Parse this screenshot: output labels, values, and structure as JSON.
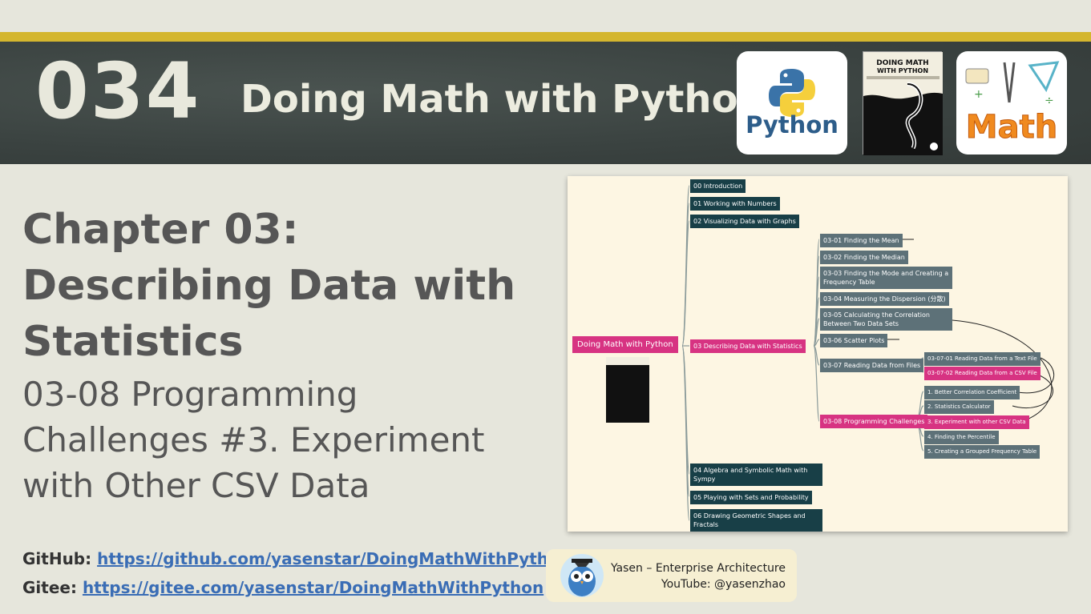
{
  "header": {
    "episode_number": "034",
    "title": "Doing Math with Python",
    "logos": {
      "python": {
        "label": "Python",
        "icon": "python-logo-icon"
      },
      "book": {
        "title": "DOING MATH WITH PYTHON",
        "icon": "book-cover-icon"
      },
      "math": {
        "label": "Math",
        "icon": "math-tools-icon"
      }
    }
  },
  "main": {
    "chapter_title": "Chapter 03: Describing Data with Statistics",
    "section_title": "03-08 Programming Challenges #3. Experiment with Other CSV Data"
  },
  "links": {
    "github_label": "GitHub:",
    "github_url": "https://github.com/yasenstar/DoingMathWithPython",
    "gitee_label": "Gitee:",
    "gitee_url": "https://gitee.com/yasenstar/DoingMathWithPython"
  },
  "mindmap": {
    "root": "Doing Math with Python",
    "chapters": [
      "00 Introduction",
      "01 Working with Numbers",
      "02 Visualizing Data with Graphs",
      "03 Describing Data with Statistics",
      "04 Algebra and Symbolic Math with Sympy",
      "05 Playing with Sets and Probability",
      "06 Drawing Geometric Shapes and Fractals"
    ],
    "ch03_sections": [
      "03-01 Finding the Mean",
      "03-02 Finding the Median",
      "03-03 Finding the Mode and Creating a Frequency Table",
      "03-04 Measuring the Dispersion (分散)",
      "03-05 Calculating the Correlation Between Two Data Sets",
      "03-06 Scatter Plots",
      "03-07 Reading Data from Files",
      "03-08 Programming Challenges"
    ],
    "ch03_07_items": [
      "03-07-01 Reading Data from a Text File",
      "03-07-02 Reading Data from a CSV File"
    ],
    "ch03_08_items": [
      "1. Better Correlation Coefficient",
      "2. Statistics Calculator",
      "3. Experiment with other CSV Data",
      "4. Finding the Percentile",
      "5. Creating a Grouped Frequency Table"
    ]
  },
  "brand": {
    "line1": "Yasen – Enterprise Architecture",
    "line2": "YouTube: @yasenzhao",
    "avatar_icon": "owl-avatar-icon"
  }
}
